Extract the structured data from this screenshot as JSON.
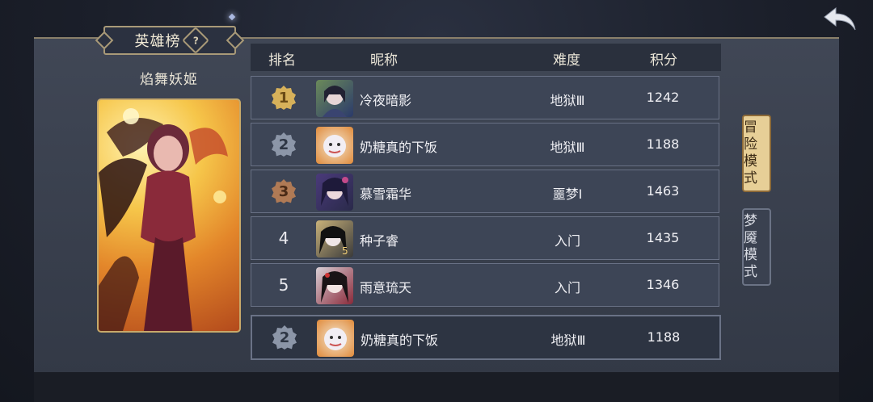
{
  "leaderboard": {
    "title": "英雄榜",
    "help_icon": "question-icon",
    "hero_name": "焰舞妖姬",
    "columns": {
      "rank": "排名",
      "nickname": "昵称",
      "difficulty": "难度",
      "score": "积分"
    },
    "rows": [
      {
        "rank": "1",
        "badge": "gold",
        "name": "冷夜暗影",
        "difficulty": "地狱Ⅲ",
        "score": "1242"
      },
      {
        "rank": "2",
        "badge": "silver",
        "name": "奶糖真的下饭",
        "difficulty": "地狱Ⅲ",
        "score": "1188"
      },
      {
        "rank": "3",
        "badge": "bronze",
        "name": "慕雪霜华",
        "difficulty": "噩梦Ⅰ",
        "score": "1463"
      },
      {
        "rank": "4",
        "badge": "none",
        "name": "种子睿",
        "difficulty": "入门",
        "score": "1435"
      },
      {
        "rank": "5",
        "badge": "none",
        "name": "雨意琉天",
        "difficulty": "入门",
        "score": "1346"
      }
    ],
    "self_row": {
      "rank": "2",
      "badge": "silver",
      "name": "奶糖真的下饭",
      "difficulty": "地狱Ⅲ",
      "score": "1188"
    }
  },
  "mode_tabs": [
    {
      "label": "冒险模式",
      "active": true
    },
    {
      "label": "梦魇模式",
      "active": false
    }
  ],
  "colors": {
    "gold": "#d7b15a",
    "silver": "#8c96a8",
    "bronze": "#b07a55",
    "panel": "#3a4150"
  }
}
